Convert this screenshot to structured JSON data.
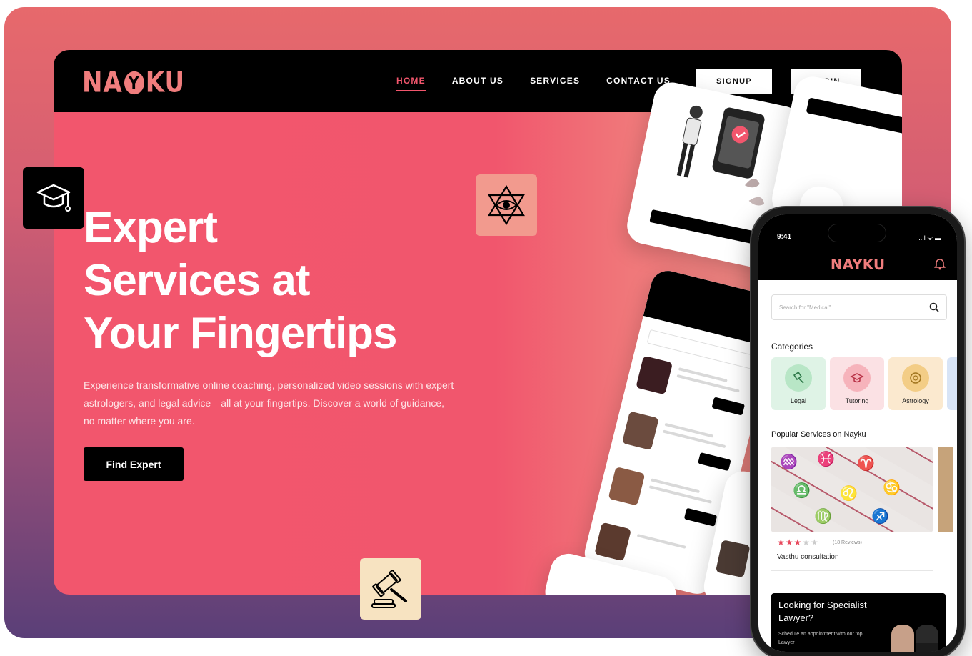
{
  "brand": {
    "logo_left": "NA",
    "logo_y": "Y",
    "logo_right": "KU",
    "accent": "#f2566d",
    "logo_color": "#f07d7d"
  },
  "nav": {
    "links": [
      "HOME",
      "ABOUT US",
      "SERVICES",
      "CONTACT US"
    ],
    "active": "HOME",
    "signup": "SIGNUP",
    "login": "LOGIN"
  },
  "hero": {
    "title_line1": "Expert",
    "title_line2": "Services at",
    "title_line3": "Your Fingertips",
    "description": "Experience transformative online coaching, personalized video sessions with expert astrologers, and legal advice—all at your fingertips. Discover a world of guidance, no matter where you are.",
    "cta": "Find Expert"
  },
  "tiles": {
    "cap_icon": "graduation-cap-icon",
    "star_icon": "star-of-david-eye-icon",
    "gavel_icon": "gavel-icon"
  },
  "phone": {
    "time": "9:41",
    "signal": "..ıl ᯤ ▬",
    "search_placeholder": "Search for \"Medical\"",
    "categories_title": "Categories",
    "categories": [
      {
        "label": "Legal",
        "bg": "#dff3e6",
        "icon_bg": "#b8e6c6"
      },
      {
        "label": "Tutoring",
        "bg": "#fbe1e4",
        "icon_bg": "#f6b3bb"
      },
      {
        "label": "Astrology",
        "bg": "#fbe9cf",
        "icon_bg": "#f3cd86"
      }
    ],
    "popular_title": "Popular Services on Nayku",
    "rating_stars": 3,
    "rating_max": 5,
    "reviews": "(18 Reviews)",
    "service_name": "Vasthu consultation",
    "promo_title": "Looking for Specialist Lawyer?",
    "promo_sub": "Schedule an appointment with our top Lawyer"
  }
}
